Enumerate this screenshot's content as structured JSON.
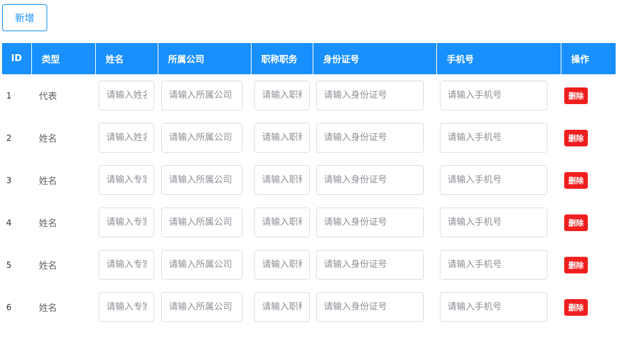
{
  "toolbar": {
    "add_label": "新增"
  },
  "table": {
    "headers": [
      "ID",
      "类型",
      "姓名",
      "所属公司",
      "职称职务",
      "身份证号",
      "手机号",
      "操作"
    ],
    "delete_label": "删除",
    "rows": [
      {
        "id": "1",
        "type": "代表",
        "name_placeholder": "请输入姓名",
        "company_placeholder": "请输入所属公司",
        "title_placeholder": "请输入职称职务",
        "idcard_placeholder": "请输入身份证号",
        "phone_placeholder": "请输入手机号"
      },
      {
        "id": "2",
        "type": "姓名",
        "name_placeholder": "请输入姓名",
        "company_placeholder": "请输入所属公司",
        "title_placeholder": "请输入职称职务",
        "idcard_placeholder": "请输入身份证号",
        "phone_placeholder": "请输入手机号"
      },
      {
        "id": "3",
        "type": "姓名",
        "name_placeholder": "请输入专家姓名",
        "company_placeholder": "请输入所属公司",
        "title_placeholder": "请输入职称职务",
        "idcard_placeholder": "请输入身份证号",
        "phone_placeholder": "请输入手机号"
      },
      {
        "id": "4",
        "type": "姓名",
        "name_placeholder": "请输入专家姓名",
        "company_placeholder": "请输入所属公司",
        "title_placeholder": "请输入职称职务",
        "idcard_placeholder": "请输入身份证号",
        "phone_placeholder": "请输入手机号"
      },
      {
        "id": "5",
        "type": "姓名",
        "name_placeholder": "请输入专家姓名",
        "company_placeholder": "请输入所属公司",
        "title_placeholder": "请输入职称职务",
        "idcard_placeholder": "请输入身份证号",
        "phone_placeholder": "请输入手机号"
      },
      {
        "id": "6",
        "type": "姓名",
        "name_placeholder": "请输入专家姓名",
        "company_placeholder": "请输入所属公司",
        "title_placeholder": "请输入职称职务",
        "idcard_placeholder": "请输入身份证号",
        "phone_placeholder": "请输入手机号"
      }
    ]
  },
  "colors": {
    "accent": "#1890ff",
    "danger": "#f01f1f"
  }
}
